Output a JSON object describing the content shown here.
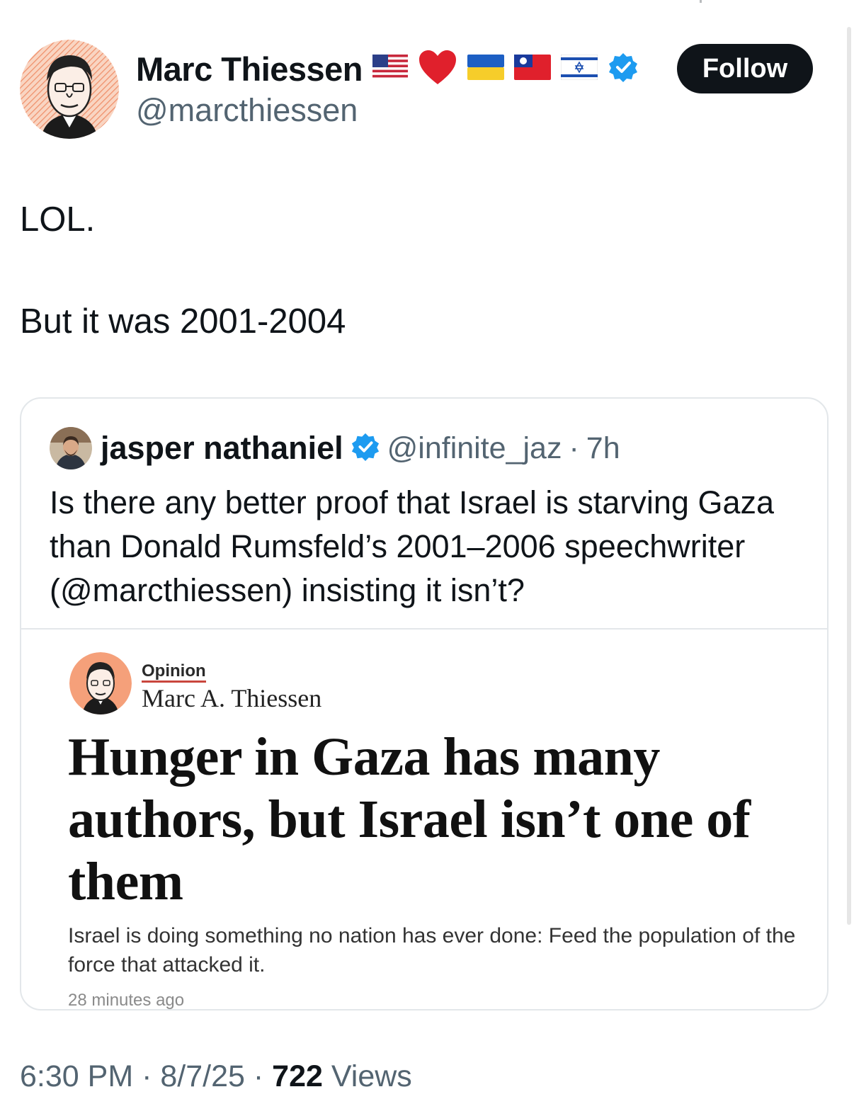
{
  "author": {
    "display_name": "Marc Thiessen",
    "handle": "@marcthiessen",
    "name_emojis": [
      "us-flag",
      "red-heart",
      "ukraine-flag",
      "taiwan-flag",
      "israel-flag"
    ],
    "verified": true
  },
  "follow_button": {
    "label": "Follow"
  },
  "tweet": {
    "lines": [
      "LOL.",
      "But it was 2001-2004"
    ]
  },
  "quoted_tweet": {
    "display_name": "jasper nathaniel",
    "handle": "@infinite_jaz",
    "separator": "·",
    "time": "7h",
    "verified": true,
    "text": "Is there any better proof that Israel is starving Gaza than Donald Rumsfeld’s 2001–2006 speechwriter (@marcthiessen) insisting it isn’t?",
    "article": {
      "section": "Opinion",
      "author": "Marc A. Thiessen",
      "headline": "Hunger in Gaza has many authors, but Israel isn’t one of them",
      "summary": "Israel is doing something no nation has ever done: Feed the population of the force that attacked it.",
      "timestamp": "28 minutes ago"
    }
  },
  "meta": {
    "time": "6:30 PM",
    "date": "8/7/25",
    "separator": "·",
    "views_count": "722",
    "views_label": "Views"
  },
  "colors": {
    "verified_blue": "#1d9bf0",
    "follow_bg": "#0f1419",
    "secondary_text": "#536471",
    "avatar_bg": "#f5a07a"
  }
}
